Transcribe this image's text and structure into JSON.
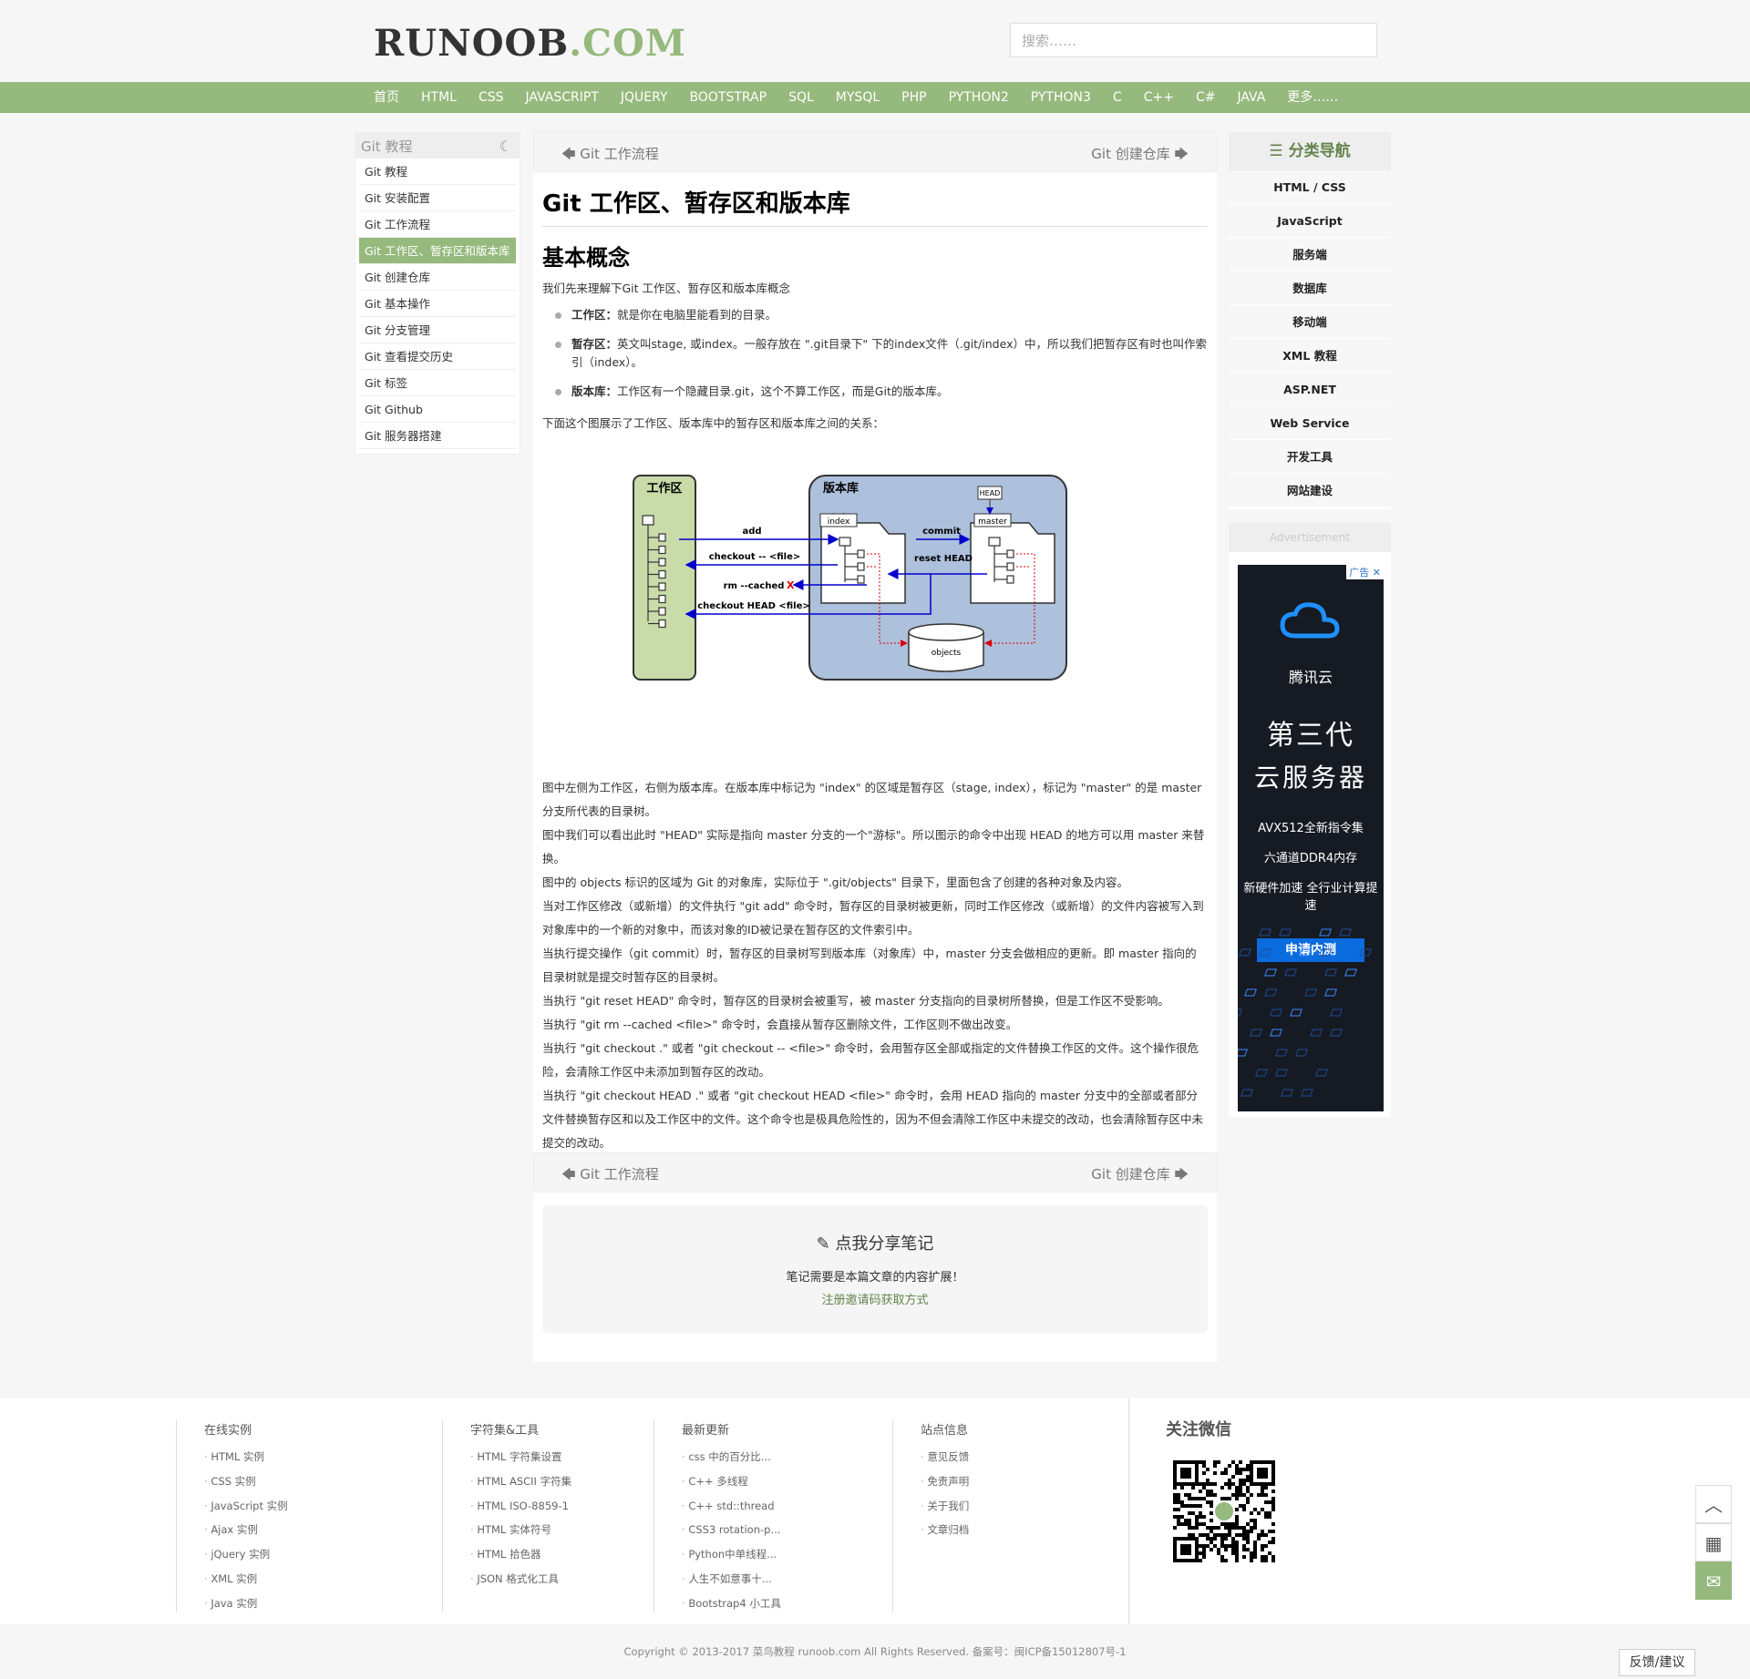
{
  "header": {
    "logo_main": "RUNOOB",
    "logo_suffix": ".COM",
    "search_placeholder": "搜索……"
  },
  "nav": [
    "首页",
    "HTML",
    "CSS",
    "JAVASCRIPT",
    "JQUERY",
    "BOOTSTRAP",
    "SQL",
    "MYSQL",
    "PHP",
    "PYTHON2",
    "PYTHON3",
    "C",
    "C++",
    "C#",
    "JAVA",
    "更多……"
  ],
  "left_sidebar": {
    "title": "Git 教程",
    "items": [
      "Git 教程",
      "Git 安装配置",
      "Git 工作流程",
      "Git 工作区、暂存区和版本库",
      "Git 创建仓库",
      "Git 基本操作",
      "Git 分支管理",
      "Git 查看提交历史",
      "Git 标签",
      "Git Github",
      "Git 服务器搭建"
    ],
    "active_index": 3
  },
  "pager": {
    "prev": "Git 工作流程",
    "next": "Git 创建仓库"
  },
  "article": {
    "title": "Git 工作区、暂存区和版本库",
    "section": "基本概念",
    "intro": "我们先来理解下Git 工作区、暂存区和版本库概念",
    "bullets": [
      {
        "term": "工作区：",
        "text": "就是你在电脑里能看到的目录。"
      },
      {
        "term": "暂存区：",
        "text": "英文叫stage, 或index。一般存放在 \".git目录下\" 下的index文件（.git/index）中，所以我们把暂存区有时也叫作索引（index）。"
      },
      {
        "term": "版本库：",
        "text": "工作区有一个隐藏目录.git，这个不算工作区，而是Git的版本库。"
      }
    ],
    "diagram_intro": "下面这个图展示了工作区、版本库中的暂存区和版本库之间的关系：",
    "paragraphs": [
      "图中左侧为工作区，右侧为版本库。在版本库中标记为 \"index\" 的区域是暂存区（stage, index），标记为 \"master\" 的是 master 分支所代表的目录树。",
      "图中我们可以看出此时 \"HEAD\" 实际是指向 master 分支的一个\"游标\"。所以图示的命令中出现 HEAD 的地方可以用 master 来替换。",
      "图中的 objects 标识的区域为 Git 的对象库，实际位于 \".git/objects\" 目录下，里面包含了创建的各种对象及内容。",
      "当对工作区修改（或新增）的文件执行 \"git add\" 命令时，暂存区的目录树被更新，同时工作区修改（或新增）的文件内容被写入到对象库中的一个新的对象中，而该对象的ID被记录在暂存区的文件索引中。",
      "当执行提交操作（git commit）时，暂存区的目录树写到版本库（对象库）中，master 分支会做相应的更新。即 master 指向的目录树就是提交时暂存区的目录树。",
      "当执行 \"git reset HEAD\" 命令时，暂存区的目录树会被重写，被 master 分支指向的目录树所替换，但是工作区不受影响。",
      "当执行 \"git rm --cached <file>\" 命令时，会直接从暂存区删除文件，工作区则不做出改变。",
      "当执行 \"git checkout .\" 或者 \"git checkout -- <file>\" 命令时，会用暂存区全部或指定的文件替换工作区的文件。这个操作很危险，会清除工作区中未添加到暂存区的改动。",
      "当执行 \"git checkout HEAD .\" 或者 \"git checkout HEAD <file>\" 命令时，会用 HEAD 指向的 master 分支中的全部或者部分文件替换暂存区和以及工作区中的文件。这个命令也是极具危险性的，因为不但会清除工作区中未提交的改动，也会清除暂存区中未提交的改动。"
    ]
  },
  "diagram": {
    "workspace": "工作区",
    "repo": "版本库",
    "index": "index",
    "master": "master",
    "head": "HEAD",
    "objects": "objects",
    "add": "add",
    "checkout_file": "checkout -- <file>",
    "rm_cached": "rm --cached",
    "checkout_head": "checkout HEAD <file>",
    "commit": "commit",
    "reset_head": "reset HEAD",
    "x_mark": "X"
  },
  "share": {
    "title": "点我分享笔记",
    "line1": "笔记需要是本篇文章的内容扩展！",
    "line2": "注册邀请码获取方式"
  },
  "right_sidebar": {
    "title": "分类导航",
    "items": [
      "HTML / CSS",
      "JavaScript",
      "服务端",
      "数据库",
      "移动端",
      "XML 教程",
      "ASP.NET",
      "Web Service",
      "开发工具",
      "网站建设"
    ]
  },
  "ad": {
    "header": "Advertisement",
    "tag": "广告",
    "brand": "腾讯云",
    "line1": "第三代",
    "line2": "云服务器",
    "f1": "AVX512全新指令集",
    "f2": "六通道DDR4内存",
    "f3": "新硬件加速 全行业计算提速",
    "button": "申请内测"
  },
  "footer": {
    "cols": [
      {
        "title": "在线实例",
        "items": [
          "HTML 实例",
          "CSS 实例",
          "JavaScript 实例",
          "Ajax 实例",
          "jQuery 实例",
          "XML 实例",
          "Java 实例"
        ]
      },
      {
        "title": "字符集&工具",
        "items": [
          "HTML 字符集设置",
          "HTML ASCII 字符集",
          "HTML ISO-8859-1",
          "HTML 实体符号",
          "HTML 拾色器",
          "JSON 格式化工具"
        ]
      },
      {
        "title": "最新更新",
        "items": [
          "css 中的百分比...",
          "C++ 多线程",
          "C++ std::thread",
          "CSS3 rotation-p...",
          "Python中单线程...",
          "人生不如意事十...",
          "Bootstrap4 小工具"
        ]
      },
      {
        "title": "站点信息",
        "items": [
          "意见反馈",
          "免责声明",
          "关于我们",
          "文章归档"
        ]
      }
    ],
    "wechat_title": "关注微信",
    "copyright": "Copyright © 2013-2017 菜鸟教程 runoob.com All Rights Reserved. 备案号：闽ICP备15012807号-1",
    "feedback": "反馈/建议"
  }
}
